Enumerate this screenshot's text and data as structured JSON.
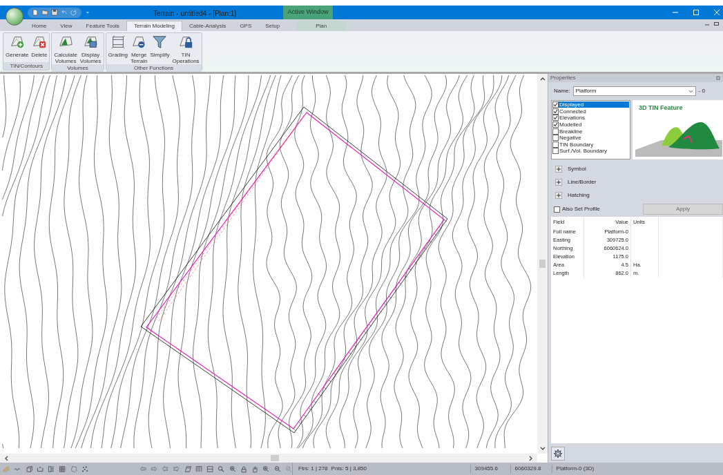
{
  "window": {
    "title": "Terrain - untitled4 - [Plan:1]",
    "context_group": "Active Window"
  },
  "tabs": [
    {
      "label": "Home",
      "selected": false,
      "kind": "normal"
    },
    {
      "label": "View",
      "selected": false,
      "kind": "normal"
    },
    {
      "label": "Feature Tools",
      "selected": false,
      "kind": "normal"
    },
    {
      "label": "Terrain Modeling",
      "selected": true,
      "kind": "normal"
    },
    {
      "label": "Cable-Analysis",
      "selected": false,
      "kind": "normal"
    },
    {
      "label": "GPS",
      "selected": false,
      "kind": "normal"
    },
    {
      "label": "Setup",
      "selected": false,
      "kind": "normal"
    },
    {
      "label": "Plan",
      "selected": false,
      "kind": "contextual"
    }
  ],
  "ribbon_groups": [
    {
      "label": "TIN/Contours",
      "buttons": [
        {
          "label": "Generate"
        },
        {
          "label": "Delete"
        }
      ]
    },
    {
      "label": "Volumes",
      "buttons": [
        {
          "label": "Calculate Volumes"
        },
        {
          "label": "Display Volumes"
        }
      ]
    },
    {
      "label": "Other Functions",
      "buttons": [
        {
          "label": "Grading"
        },
        {
          "label": "Merge Terrain"
        },
        {
          "label": "Simplify"
        },
        {
          "label": "TIN Operations"
        }
      ]
    }
  ],
  "properties": {
    "title": "Properties",
    "name_label": "Name:",
    "name_value": "Platform",
    "name_suffix": "- 0",
    "flags": [
      {
        "label": "Displayed",
        "checked": true,
        "selected": true
      },
      {
        "label": "Connected",
        "checked": true,
        "selected": false
      },
      {
        "label": "Elevations",
        "checked": true,
        "selected": false
      },
      {
        "label": "Modelled",
        "checked": true,
        "selected": false
      },
      {
        "label": "Breakline",
        "checked": false,
        "selected": false
      },
      {
        "label": "Negative",
        "checked": false,
        "selected": false
      },
      {
        "label": "TIN Boundary",
        "checked": false,
        "selected": false
      },
      {
        "label": "Surf./Vol. Boundary",
        "checked": false,
        "selected": false
      }
    ],
    "preview_title": "3D TIN Feature",
    "sections": [
      {
        "label": "Symbol",
        "expanded": false
      },
      {
        "label": "Line/Border",
        "expanded": false
      },
      {
        "label": "Hatching",
        "expanded": false
      }
    ],
    "also_set_profile": {
      "label": "Also Set Profile",
      "checked": false
    },
    "apply_button": {
      "label": "Apply",
      "disabled": true
    },
    "table": {
      "columns": [
        "Field",
        "Value",
        "Units"
      ],
      "rows": [
        [
          "Full name",
          "Platform-0",
          ""
        ],
        [
          "Easting",
          "309725.0",
          ""
        ],
        [
          "Northing",
          "6060624.0",
          ""
        ],
        [
          "Elevation",
          "1175.0",
          ""
        ],
        [
          "Area",
          "4.5",
          "Ha."
        ],
        [
          "Length",
          "862.0",
          "m."
        ]
      ]
    }
  },
  "status_bar": {
    "features": "Ftrs: 1 | 278",
    "points": "Pnts: 5 | 3,850",
    "easting": "309455.6",
    "northing": "6060329.8",
    "feature": "Platform-0 (3D)"
  }
}
